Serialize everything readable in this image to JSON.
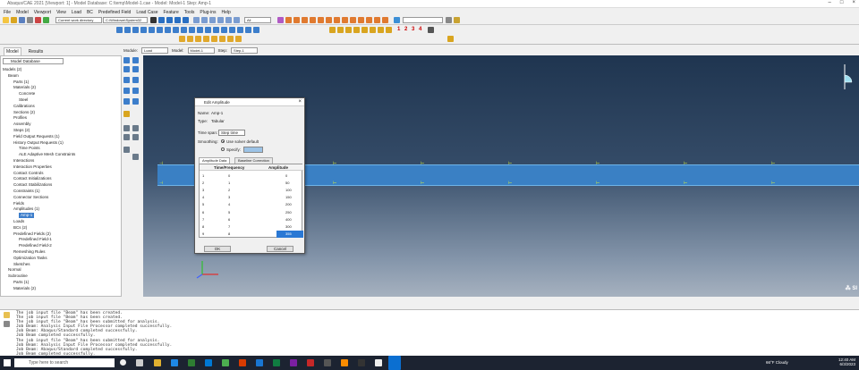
{
  "window": {
    "title": "Abaqus/CAE 2021 [Viewport: 1] - Model Database: C:\\temp\\Model-1.cae - Model: Model-1 Step: Amp-1"
  },
  "menu": [
    "File",
    "Model",
    "Viewport",
    "View",
    "Load",
    "BC",
    "Predefined Field",
    "Load Case",
    "Feature",
    "Tools",
    "Plug-ins",
    "Help"
  ],
  "toolbar": {
    "work_dir_label": "Current work directory",
    "work_dir_value": "C:\\Windows\\System32",
    "view_field": "All"
  },
  "tabs": [
    "Model",
    "Results"
  ],
  "context": {
    "module_label": "Module:",
    "module_value": "Load",
    "model_label": "Model:",
    "model_value": "Model-1",
    "step_label": "Step:",
    "step_value": "Step-1"
  },
  "tree": {
    "selector": "Model Database",
    "items": [
      {
        "label": "Models (2)"
      },
      {
        "label": "Beam"
      },
      {
        "label": "Parts (1)"
      },
      {
        "label": "Materials (2)"
      },
      {
        "label": "Concrete"
      },
      {
        "label": "Steel"
      },
      {
        "label": "Calibrations"
      },
      {
        "label": "Sections (2)"
      },
      {
        "label": "Profiles"
      },
      {
        "label": "Assembly"
      },
      {
        "label": "Steps (2)"
      },
      {
        "label": "Field Output Requests (1)"
      },
      {
        "label": "History Output Requests (1)"
      },
      {
        "label": "Time Points"
      },
      {
        "label": "ALE Adaptive Mesh Constraints"
      },
      {
        "label": "Interactions"
      },
      {
        "label": "Interaction Properties"
      },
      {
        "label": "Contact Controls"
      },
      {
        "label": "Contact Initializations"
      },
      {
        "label": "Contact Stabilizations"
      },
      {
        "label": "Constraints (1)"
      },
      {
        "label": "Connector Sections"
      },
      {
        "label": "Fields"
      },
      {
        "label": "Amplitudes (1)"
      },
      {
        "label": "Amp-1"
      },
      {
        "label": "Loads"
      },
      {
        "label": "BCs (2)"
      },
      {
        "label": "Predefined Fields (2)"
      },
      {
        "label": "Predefined Field-1"
      },
      {
        "label": "Predefined Field-2"
      },
      {
        "label": "Remeshing Rules"
      },
      {
        "label": "Optimization Tasks"
      },
      {
        "label": "Sketches"
      },
      {
        "label": "Normal"
      },
      {
        "label": "Subroutine"
      },
      {
        "label": "Parts (1)"
      },
      {
        "label": "Materials (2)"
      }
    ]
  },
  "dialog": {
    "title": "Edit Amplitude",
    "name_label": "Name:",
    "name_value": "Amp-1",
    "type_label": "Type:",
    "type_value": "Tabular",
    "timespan_label": "Time span:",
    "timespan_value": "Step time",
    "smoothing_label": "Smoothing:",
    "opt_default": "Use solver default",
    "opt_specify": "Specify:",
    "tab_amp": "Amplitude Data",
    "tab_baseline": "Baseline Correction",
    "col_time": "Time/Frequency",
    "col_amp": "Amplitude",
    "rows": [
      {
        "i": "1",
        "t": "0",
        "a": "0"
      },
      {
        "i": "2",
        "t": "1",
        "a": "50"
      },
      {
        "i": "3",
        "t": "2",
        "a": "100"
      },
      {
        "i": "4",
        "t": "3",
        "a": "150"
      },
      {
        "i": "5",
        "t": "4",
        "a": "200"
      },
      {
        "i": "6",
        "t": "5",
        "a": "250"
      },
      {
        "i": "7",
        "t": "6",
        "a": "400"
      },
      {
        "i": "8",
        "t": "7",
        "a": "300"
      },
      {
        "i": "9",
        "t": "8",
        "a": "355"
      }
    ],
    "ok": "OK",
    "cancel": "Cancel"
  },
  "messages": [
    "The job input file \"Beam\" has been created.",
    "The job input file \"Beam\" has been created.",
    "The job input file \"Beam\" has been submitted for analysis.",
    "Job Beam: Analysis Input File Processor completed successfully.",
    "Job Beam: Abaqus/Standard completed successfully.",
    "Job Beam completed successfully.",
    "The job input file \"Beam\" has been submitted for analysis.",
    "Job Beam: Analysis Input File Processor completed successfully.",
    "Job Beam: Abaqus/Standard completed successfully.",
    "Job Beam completed successfully."
  ],
  "taskbar": {
    "search_placeholder": "Type here to search",
    "weather": "66°F Cloudy",
    "time": "12:40 AM",
    "date": "6/3/2023"
  },
  "colors": {
    "viewport_top": "#1f3550",
    "beam": "#3a80c4",
    "selection": "#2a78d4"
  }
}
